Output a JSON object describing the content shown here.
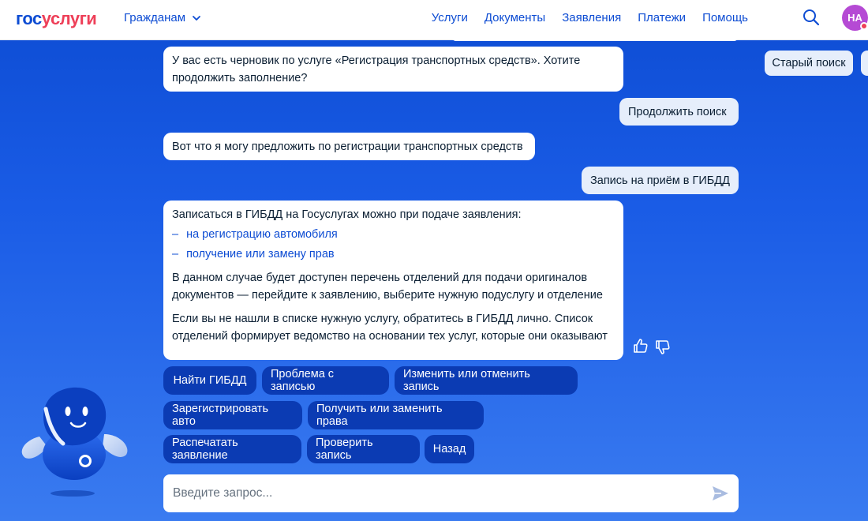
{
  "header": {
    "logo_part1": "гос",
    "logo_part2": "услуги",
    "audience": "Гражданам",
    "nav": [
      "Услуги",
      "Документы",
      "Заявления",
      "Платежи",
      "Помощь"
    ],
    "avatar_initials": "НА"
  },
  "sidebar": {
    "old_search": "Старый поиск"
  },
  "chat": {
    "msg1": "У вас есть черновик по услуге «Регистрация транспортных средств». Хотите продолжить заполнение?",
    "user1": "Продолжить поиск",
    "msg2": "Вот что я могу предложить по регистрации транспортных средств",
    "user2": "Запись на приём в ГИБДД",
    "msg3_intro": "Записаться в ГИБДД на Госуслугах можно при подаче заявления:",
    "msg3_dash": "–",
    "msg3_link1": "на регистрацию автомобиля",
    "msg3_link2": "получение или замену прав",
    "msg3_para1": "В данном случае будет доступен перечень отделений для подачи оригиналов документов — перейдите к заявлению, выберите нужную подуслугу и отделение",
    "msg3_para2": "Если вы не нашли в списке нужную услугу, обратитесь в ГИБДД лично. Список отделений формирует ведомство на основании тех услуг, которые они оказывают"
  },
  "actions": [
    "Найти ГИБДД",
    "Проблема с записью",
    "Изменить или отменить запись",
    "Зарегистрировать авто",
    "Получить или заменить права",
    "Распечатать заявление",
    "Проверить запись",
    "Назад"
  ],
  "input": {
    "placeholder": "Введите запрос..."
  },
  "colors": {
    "brand_blue": "#0d4cd3",
    "brand_red": "#ee3f58",
    "button_dark": "#0b3bb3"
  }
}
